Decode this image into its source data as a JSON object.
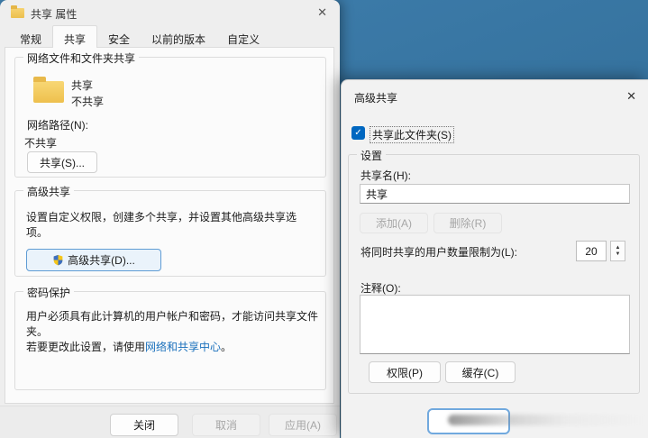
{
  "icons": {
    "close": "✕",
    "spin_up": "▲",
    "spin_down": "▼",
    "check": "✓"
  },
  "colors": {
    "accent": "#0067c0",
    "link": "#1a70bc",
    "desktop_top": "#3f7fae",
    "desktop_bottom": "#2c668d"
  },
  "properties_dialog": {
    "title": "共享 属性",
    "tabs": [
      "常规",
      "共享",
      "安全",
      "以前的版本",
      "自定义"
    ],
    "active_tab": "共享",
    "network_group": {
      "title": "网络文件和文件夹共享",
      "folder_name": "共享",
      "folder_state": "不共享",
      "path_label": "网络路径(N):",
      "path_value": "不共享",
      "share_button": "共享(S)..."
    },
    "advanced_group": {
      "title": "高级共享",
      "description": "设置自定义权限，创建多个共享，并设置其他高级共享选项。",
      "button": "高级共享(D)..."
    },
    "password_group": {
      "title": "密码保护",
      "line1": "用户必须具有此计算机的用户帐户和密码，才能访问共享文件夹。",
      "line2_prefix": "若要更改此设置，请使用",
      "line2_link": "网络和共享中心",
      "line2_suffix": "。"
    },
    "footer": {
      "close_button": "关闭",
      "cancel_button": "取消",
      "apply_button": "应用(A)"
    }
  },
  "advanced_dialog": {
    "title": "高级共享",
    "share_checkbox_label": "共享此文件夹(S)",
    "share_checkbox_checked": true,
    "settings_group": {
      "title": "设置",
      "share_name_label": "共享名(H):",
      "share_name_value": "共享",
      "add_button": "添加(A)",
      "delete_button": "删除(R)",
      "limit_label": "将同时共享的用户数量限制为(L):",
      "limit_value": "20",
      "comment_label": "注释(O):",
      "comment_value": "",
      "permissions_button": "权限(P)",
      "caching_button": "缓存(C)"
    }
  }
}
